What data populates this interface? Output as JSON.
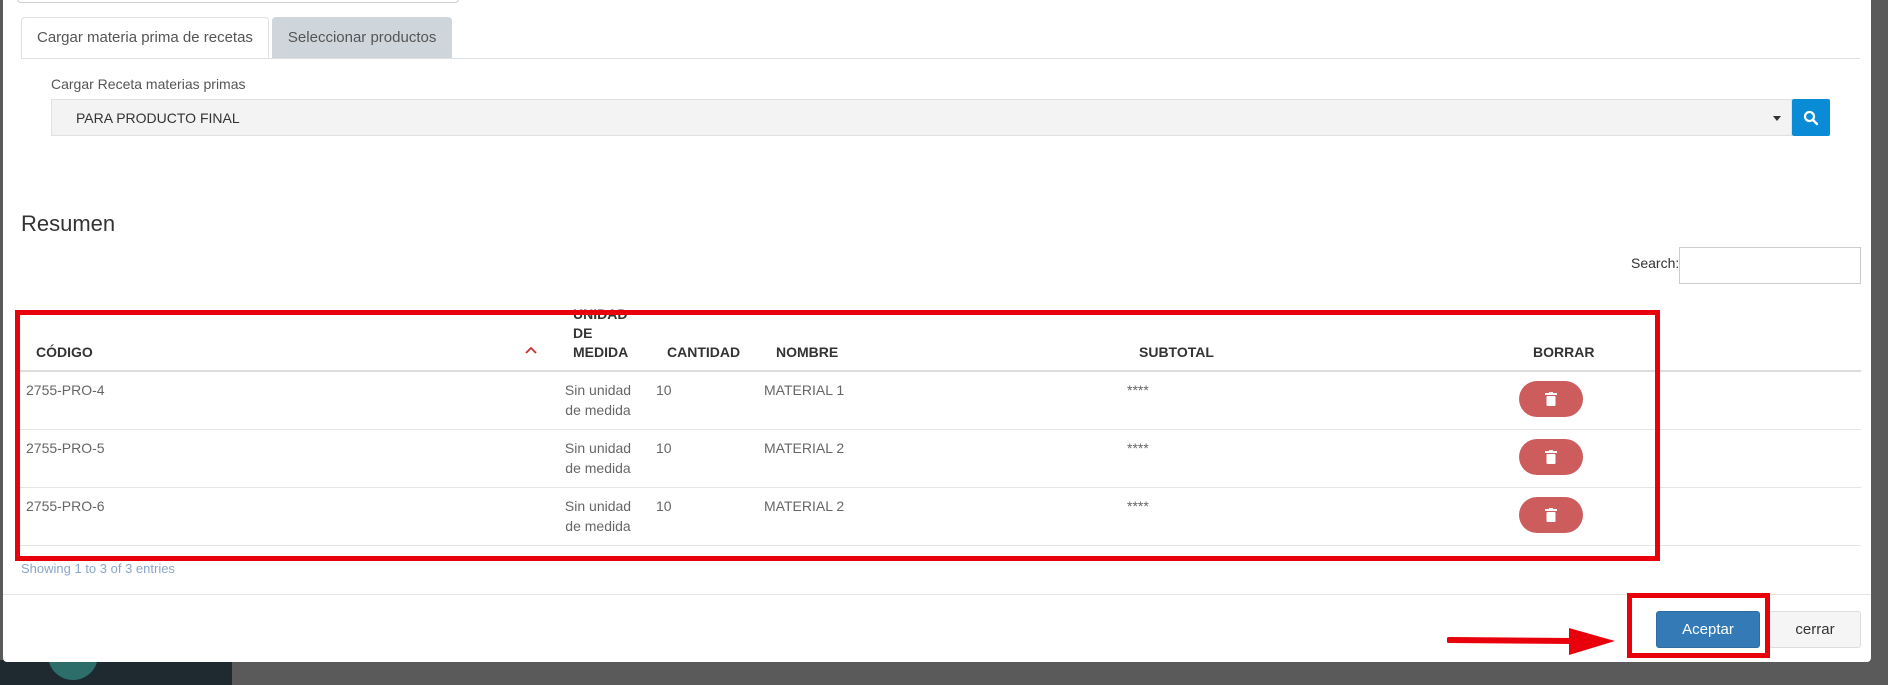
{
  "tabs": [
    {
      "label": "Cargar materia prima de recetas",
      "active": true
    },
    {
      "label": "Seleccionar productos",
      "active": false
    }
  ],
  "select": {
    "label": "Cargar Receta materias primas",
    "value": "PARA PRODUCTO FINAL"
  },
  "section": {
    "title": "Resumen",
    "search_label": "Search:"
  },
  "table": {
    "headers": {
      "codigo": "CÓDIGO",
      "unidad_1": "UNIDAD",
      "unidad_2": "DE",
      "unidad_3": "MEDIDA",
      "cantidad": "CANTIDAD",
      "nombre": "NOMBRE",
      "subtotal": "SUBTOTAL",
      "borrar": "BORRAR"
    },
    "rows": [
      {
        "codigo": "2755-PRO-4",
        "unidad_1": "Sin unidad",
        "unidad_2": "de medida",
        "cantidad": "10",
        "nombre": "MATERIAL 1",
        "subtotal": "****"
      },
      {
        "codigo": "2755-PRO-5",
        "unidad_1": "Sin unidad",
        "unidad_2": "de medida",
        "cantidad": "10",
        "nombre": "MATERIAL 2",
        "subtotal": "****"
      },
      {
        "codigo": "2755-PRO-6",
        "unidad_1": "Sin unidad",
        "unidad_2": "de medida",
        "cantidad": "10",
        "nombre": "MATERIAL 2",
        "subtotal": "****"
      }
    ],
    "showing": "Showing 1 to 3 of 3 entries"
  },
  "footer": {
    "accept_label": "Aceptar",
    "close_label": "cerrar"
  },
  "colors": {
    "accent": "#337ab7",
    "search_button": "#0a8bd6",
    "delete_button": "#cd5c5c",
    "annotation": "#e8000b"
  },
  "icons": [
    "search-icon",
    "sort-ascending-icon",
    "trash-icon",
    "arrow-right-icon"
  ]
}
